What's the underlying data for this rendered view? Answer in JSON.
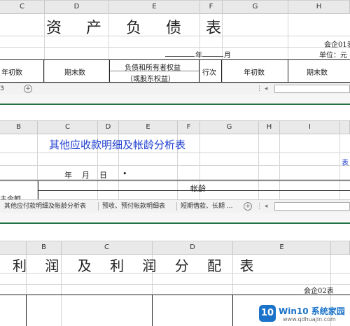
{
  "window1": {
    "columns": [
      "C",
      "D",
      "E",
      "F",
      "G",
      "H"
    ],
    "title": "资 产 负 债 表",
    "form_no": "会企01表",
    "date_year": "年",
    "date_month": "月",
    "unit_label": "单位：元",
    "headers": {
      "begin": "年初数",
      "end": "期末数",
      "liab_top": "负债和所有者权益",
      "liab_bottom": "（或股东权益）",
      "row_no": "行次",
      "begin2": "年初数",
      "end2": "期末数"
    },
    "tab_label": "3",
    "add_icon": "plus-circle-icon"
  },
  "window2": {
    "columns": [
      "B",
      "C",
      "D",
      "E",
      "F",
      "G",
      "H",
      "I"
    ],
    "title": "其他应收款明细及帐龄分析表",
    "right_note": "表",
    "date_text": "年    月    日",
    "dot": "•",
    "left_clip": "主今额",
    "aging_header": "帐龄",
    "tabs": [
      "其他应付款明细及帐龄分析表",
      "预收、预付帐款明细表",
      "短期借款、长期 ..."
    ],
    "add_icon": "plus-circle-icon"
  },
  "window3": {
    "columns": [
      "B",
      "C",
      "D",
      "E"
    ],
    "title": "利 润 及 利 润 分 配 表",
    "form_no": "会企02表"
  },
  "watermark": {
    "logo_text": "10",
    "brand": "Win10 系统家园",
    "url": "www.qdhuajin.com"
  },
  "colors": {
    "title_blue": "#1f3fd0",
    "green_accent": "#217346",
    "brand_blue": "#1a73c8"
  }
}
